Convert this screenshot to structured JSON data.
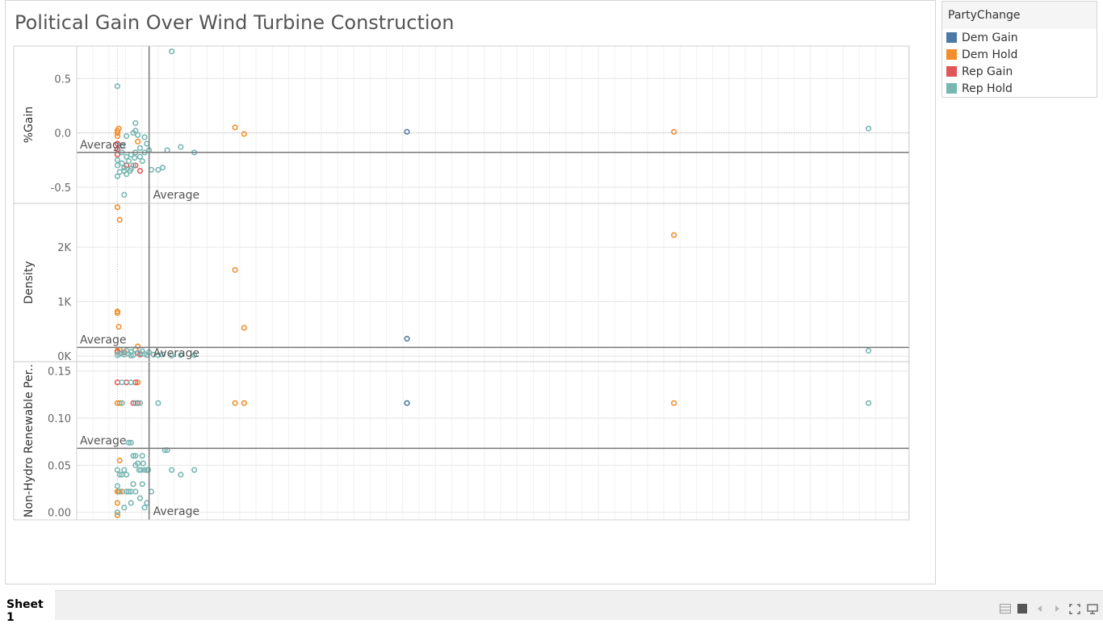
{
  "title": "Political Gain Over Wind Turbine Construction",
  "legend": {
    "title": "PartyChange",
    "items": [
      {
        "label": "Dem Gain",
        "color": "#4e79a7"
      },
      {
        "label": "Dem Hold",
        "color": "#f28e2b"
      },
      {
        "label": "Rep Gain",
        "color": "#e15759"
      },
      {
        "label": "Rep Hold",
        "color": "#76b7b2"
      }
    ]
  },
  "reference_line_label": "Average",
  "tabs": [
    {
      "label": "Sheet 1"
    }
  ],
  "toolbar_icons": [
    "show-sheets-icon",
    "filmstrip-icon",
    "previous-icon",
    "next-icon",
    "fullscreen-icon",
    "presentation-icon"
  ],
  "chart_data": [
    {
      "type": "scatter",
      "ylabel": "%Gain",
      "ylim": [
        -0.65,
        0.8
      ],
      "yticks": [
        {
          "v": 0.5,
          "label": "0.5"
        },
        {
          "v": 0.0,
          "label": "0.0"
        },
        {
          "v": -0.5,
          "label": "-0.5"
        }
      ],
      "xlim": [
        -9,
        175
      ],
      "x_average": 7,
      "y_average": -0.18,
      "series": [
        {
          "name": "Dem Gain",
          "color": "#4e79a7",
          "points": [
            [
              64,
              0.01
            ]
          ]
        },
        {
          "name": "Dem Hold",
          "color": "#f28e2b",
          "points": [
            [
              0,
              0.0
            ],
            [
              0,
              0.02
            ],
            [
              0.3,
              0.04
            ],
            [
              4.5,
              -0.08
            ],
            [
              26,
              0.05
            ],
            [
              28,
              -0.01
            ],
            [
              123,
              0.01
            ],
            [
              0,
              -0.03
            ]
          ]
        },
        {
          "name": "Rep Gain",
          "color": "#e15759",
          "points": [
            [
              0,
              -0.1
            ],
            [
              0,
              -0.15
            ],
            [
              0,
              -0.2
            ],
            [
              2,
              -0.3
            ],
            [
              4,
              -0.3
            ],
            [
              5,
              -0.35
            ]
          ]
        },
        {
          "name": "Rep Hold",
          "color": "#76b7b2",
          "points": [
            [
              0,
              0.43
            ],
            [
              12,
              0.75
            ],
            [
              1.5,
              -0.57
            ],
            [
              166,
              0.04
            ],
            [
              0,
              -0.25
            ],
            [
              0,
              -0.3
            ],
            [
              0,
              -0.4
            ],
            [
              1,
              -0.28
            ],
            [
              1.5,
              -0.35
            ],
            [
              2,
              -0.38
            ],
            [
              2,
              -0.22
            ],
            [
              2.5,
              -0.26
            ],
            [
              3,
              -0.2
            ],
            [
              3,
              -0.33
            ],
            [
              3.5,
              -0.3
            ],
            [
              4,
              -0.18
            ],
            [
              4,
              0.09
            ],
            [
              3.5,
              0.0
            ],
            [
              4,
              0.02
            ],
            [
              4.5,
              -0.02
            ],
            [
              5,
              -0.14
            ],
            [
              5.5,
              -0.26
            ],
            [
              6,
              -0.04
            ],
            [
              6,
              -0.18
            ],
            [
              6.5,
              -0.1
            ],
            [
              7,
              -0.16
            ],
            [
              7.5,
              -0.34
            ],
            [
              9,
              -0.34
            ],
            [
              10,
              -0.32
            ],
            [
              11,
              -0.16
            ],
            [
              14,
              -0.13
            ],
            [
              17,
              -0.18
            ],
            [
              1,
              -0.12
            ],
            [
              1,
              -0.18
            ],
            [
              3.8,
              -0.23
            ],
            [
              5,
              -0.22
            ],
            [
              2,
              -0.03
            ],
            [
              1.5,
              -0.32
            ],
            [
              0.5,
              -0.36
            ],
            [
              2.8,
              -0.35
            ]
          ]
        }
      ]
    },
    {
      "type": "scatter",
      "ylabel": "Density",
      "ylim": [
        -100,
        2800
      ],
      "yticks": [
        {
          "v": 2000,
          "label": "2K"
        },
        {
          "v": 1000,
          "label": "1K"
        },
        {
          "v": 0,
          "label": "0K"
        }
      ],
      "xlim": [
        -9,
        175
      ],
      "x_average": 7,
      "y_average": 160,
      "series": [
        {
          "name": "Dem Gain",
          "color": "#4e79a7",
          "points": [
            [
              64,
              320
            ]
          ]
        },
        {
          "name": "Dem Hold",
          "color": "#f28e2b",
          "points": [
            [
              0,
              2730
            ],
            [
              0.5,
              2500
            ],
            [
              26,
              1580
            ],
            [
              28,
              520
            ],
            [
              123,
              2220
            ],
            [
              0,
              820
            ],
            [
              0,
              790
            ],
            [
              0.3,
              540
            ],
            [
              4.5,
              180
            ],
            [
              0,
              100
            ],
            [
              0.5,
              120
            ],
            [
              1,
              60
            ]
          ]
        },
        {
          "name": "Rep Gain",
          "color": "#e15759",
          "points": [
            [
              0,
              80
            ],
            [
              1.5,
              70
            ],
            [
              4.5,
              60
            ],
            [
              5,
              30
            ]
          ]
        },
        {
          "name": "Rep Hold",
          "color": "#76b7b2",
          "points": [
            [
              166,
              100
            ],
            [
              0,
              20
            ],
            [
              1,
              60
            ],
            [
              2,
              100
            ],
            [
              2.5,
              40
            ],
            [
              3,
              80
            ],
            [
              3.5,
              20
            ],
            [
              4,
              120
            ],
            [
              5,
              50
            ],
            [
              5.5,
              90
            ],
            [
              6,
              40
            ],
            [
              6.5,
              20
            ],
            [
              7,
              70
            ],
            [
              8,
              30
            ],
            [
              9,
              20
            ],
            [
              10,
              30
            ],
            [
              12,
              10
            ],
            [
              14,
              20
            ],
            [
              17,
              20
            ],
            [
              1.5,
              30
            ],
            [
              3,
              10
            ],
            [
              0.5,
              40
            ]
          ]
        }
      ]
    },
    {
      "type": "scatter",
      "ylabel": "Non-Hydro Renewable Per..",
      "ylim": [
        -0.008,
        0.16
      ],
      "yticks": [
        {
          "v": 0.15,
          "label": "0.15"
        },
        {
          "v": 0.1,
          "label": "0.10"
        },
        {
          "v": 0.05,
          "label": "0.05"
        },
        {
          "v": 0.0,
          "label": "0.00"
        }
      ],
      "xlim": [
        -9,
        175
      ],
      "x_average": 7,
      "y_average": 0.068,
      "series": [
        {
          "name": "Dem Gain",
          "color": "#4e79a7",
          "points": [
            [
              64,
              0.116
            ]
          ]
        },
        {
          "name": "Dem Hold",
          "color": "#f28e2b",
          "points": [
            [
              0,
              0.116
            ],
            [
              0.5,
              0.116
            ],
            [
              4.5,
              0.138
            ],
            [
              26,
              0.116
            ],
            [
              28,
              0.116
            ],
            [
              123,
              0.116
            ],
            [
              0.5,
              0.055
            ],
            [
              0,
              0.022
            ],
            [
              0.3,
              0.022
            ],
            [
              1,
              0.022
            ],
            [
              0,
              0.01
            ],
            [
              0,
              -0.003
            ]
          ]
        },
        {
          "name": "Rep Gain",
          "color": "#e15759",
          "points": [
            [
              0,
              0.138
            ],
            [
              2,
              0.138
            ],
            [
              4,
              0.138
            ],
            [
              4.5,
              0.116
            ],
            [
              3.5,
              0.116
            ]
          ]
        },
        {
          "name": "Rep Hold",
          "color": "#76b7b2",
          "points": [
            [
              166,
              0.116
            ],
            [
              1,
              0.116
            ],
            [
              1,
              0.138
            ],
            [
              3,
              0.138
            ],
            [
              4,
              0.116
            ],
            [
              5,
              0.116
            ],
            [
              9,
              0.116
            ],
            [
              2.5,
              0.074
            ],
            [
              3,
              0.074
            ],
            [
              10.5,
              0.066
            ],
            [
              11,
              0.066
            ],
            [
              12,
              0.045
            ],
            [
              14,
              0.04
            ],
            [
              17,
              0.045
            ],
            [
              3.5,
              0.06
            ],
            [
              4,
              0.06
            ],
            [
              5.5,
              0.06
            ],
            [
              4,
              0.05
            ],
            [
              4.5,
              0.052
            ],
            [
              4.8,
              0.045
            ],
            [
              5.2,
              0.045
            ],
            [
              5.7,
              0.052
            ],
            [
              6,
              0.045
            ],
            [
              6.5,
              0.045
            ],
            [
              6.8,
              0.045
            ],
            [
              1,
              0.04
            ],
            [
              1.5,
              0.045
            ],
            [
              2,
              0.04
            ],
            [
              0,
              0.045
            ],
            [
              0.5,
              0.04
            ],
            [
              0,
              0.028
            ],
            [
              0.5,
              0.022
            ],
            [
              2,
              0.022
            ],
            [
              2.5,
              0.022
            ],
            [
              3,
              0.022
            ],
            [
              4,
              0.022
            ],
            [
              3.5,
              0.03
            ],
            [
              5.5,
              0.03
            ],
            [
              7.5,
              0.022
            ],
            [
              5,
              0.015
            ],
            [
              1.5,
              0.005
            ],
            [
              3,
              0.01
            ],
            [
              6,
              0.005
            ],
            [
              6.5,
              0.01
            ],
            [
              0,
              0.0
            ]
          ]
        }
      ]
    }
  ]
}
